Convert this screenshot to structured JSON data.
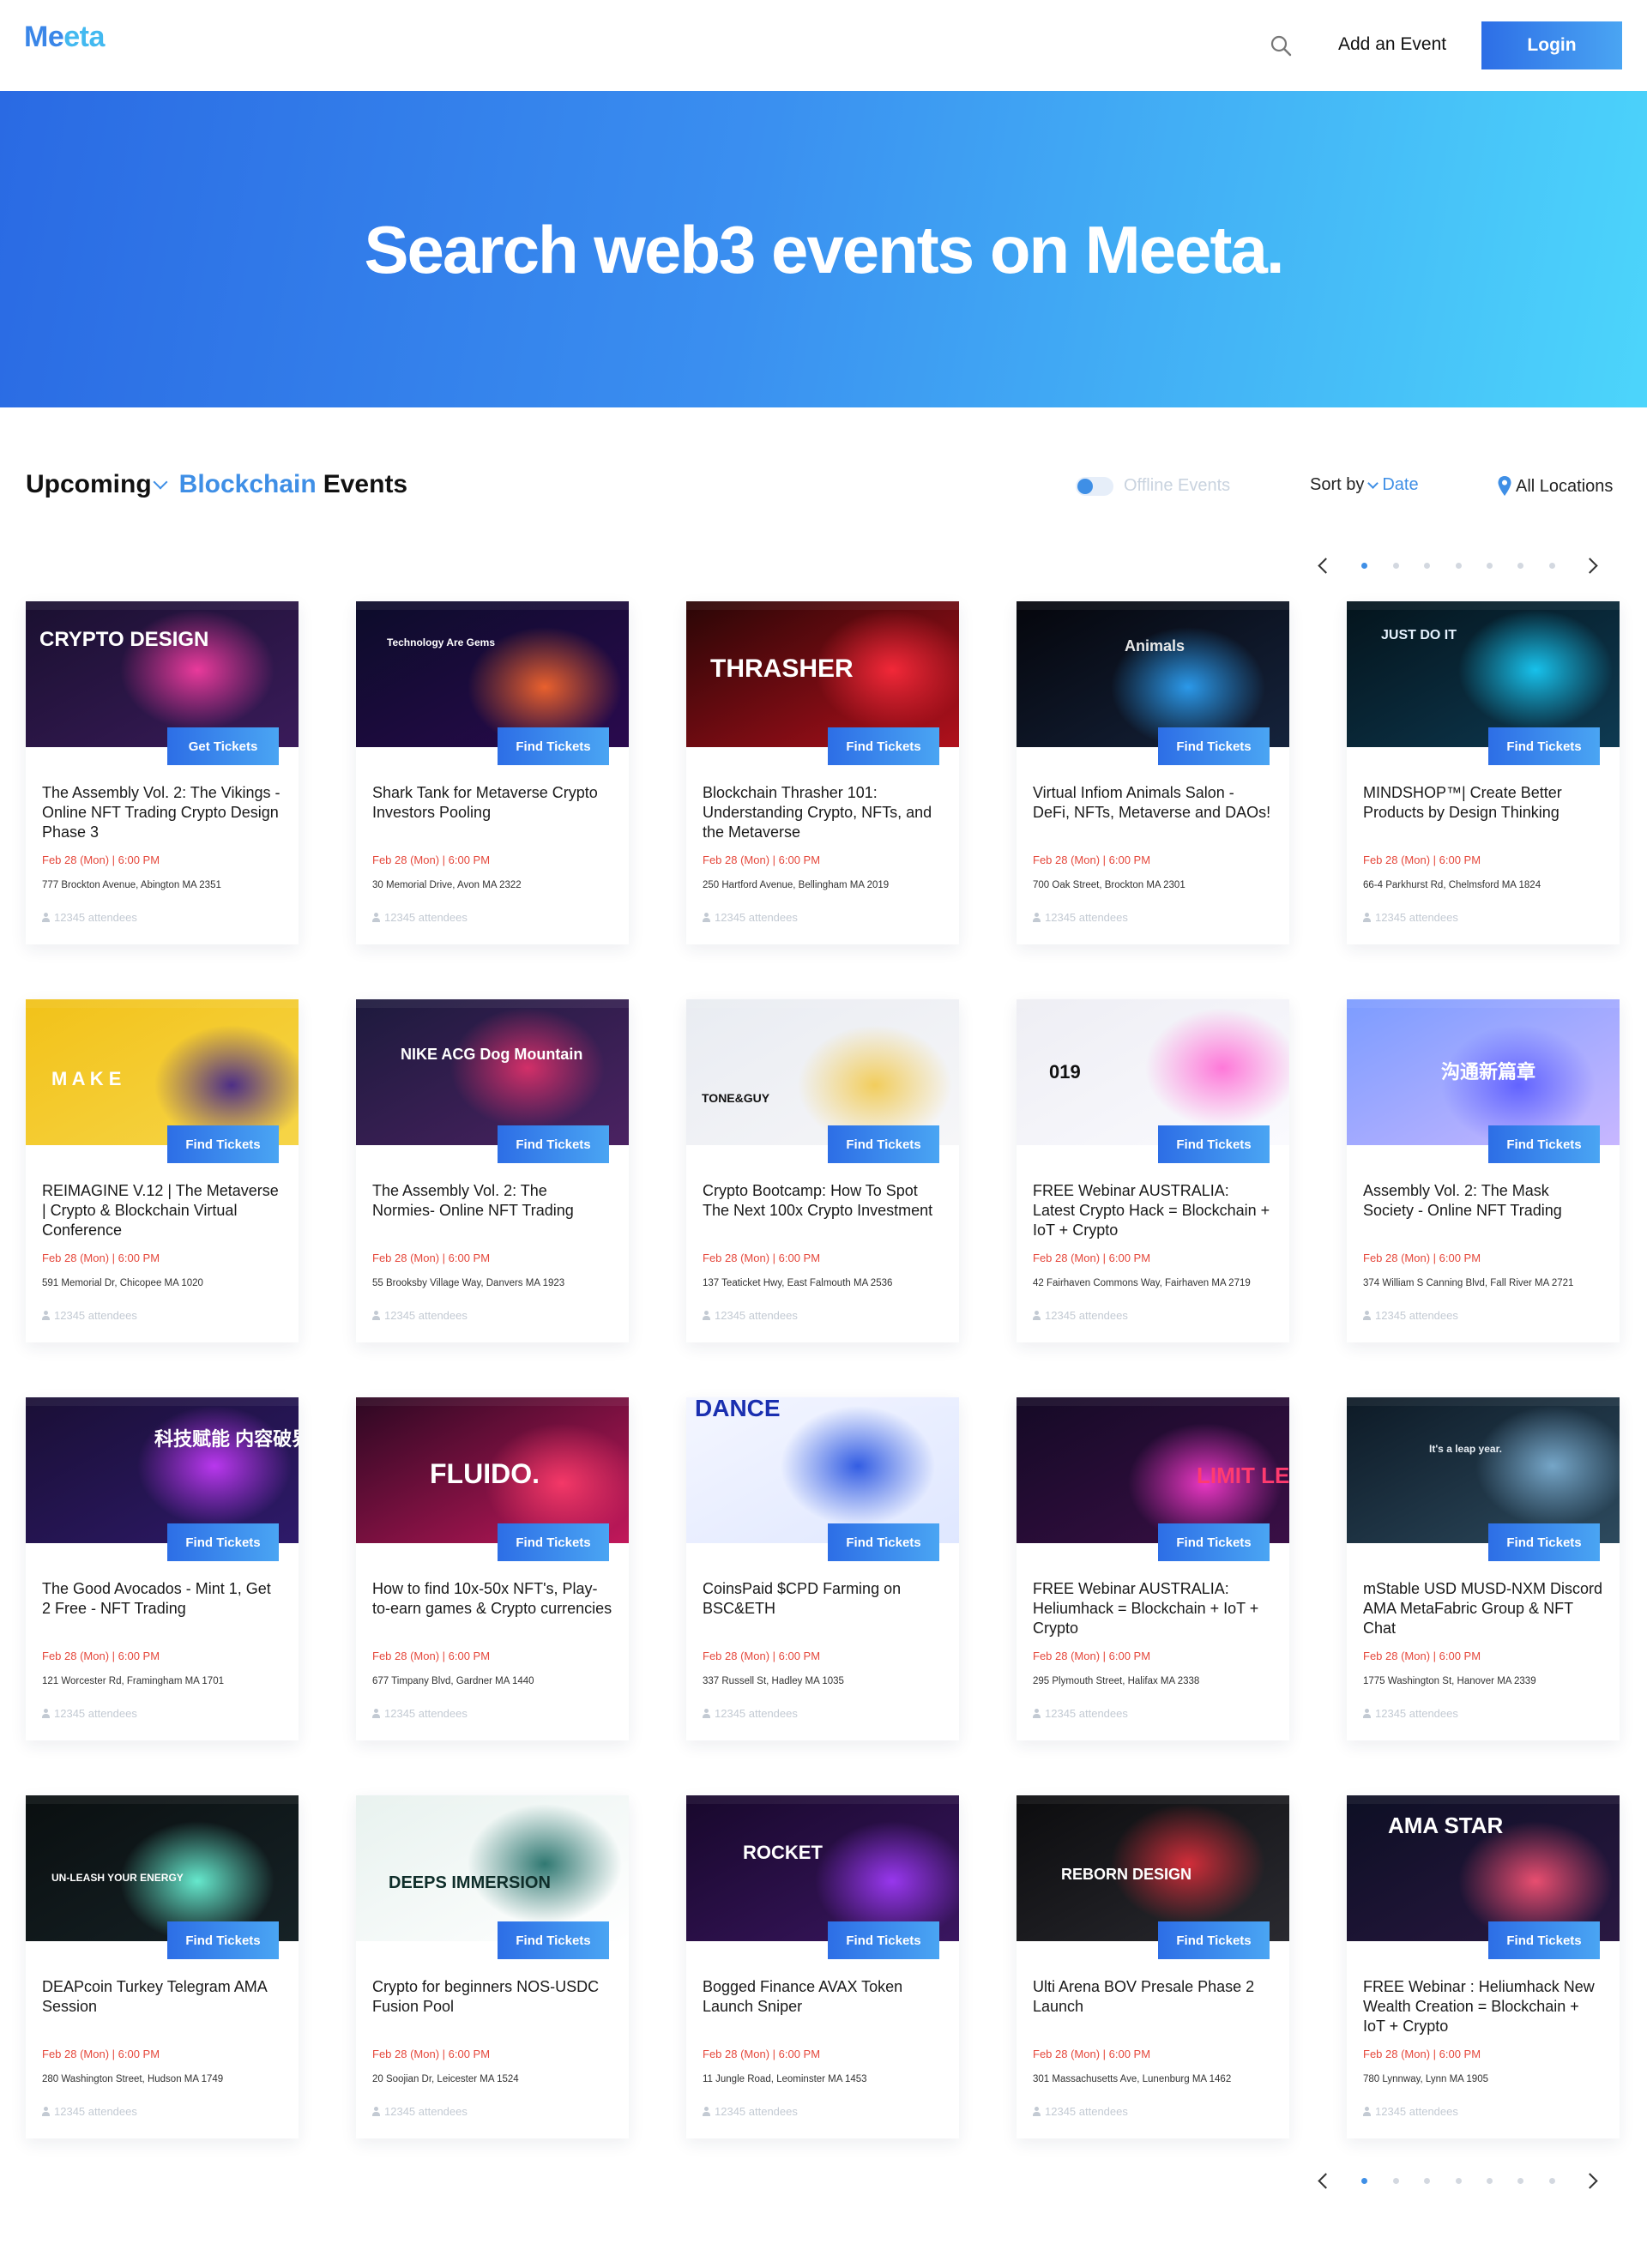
{
  "header": {
    "logo": "Meeta",
    "add_event_label": "Add an Event",
    "login_label": "Login"
  },
  "hero": {
    "title": "Search web3 events on Meeta."
  },
  "toolbar": {
    "time_filter": "Upcoming",
    "category_filter": "Blockchain",
    "events_word": "Events",
    "offline_label": "Offline Events",
    "sort_label": "Sort by",
    "sort_value": "Date",
    "location_label": "All Locations"
  },
  "pager": {
    "pages": 7,
    "active": 1
  },
  "colors": {
    "accent": "#3f8fe6",
    "date_red": "#e5483c",
    "brand_gradient_start": "#2a6ae3",
    "brand_gradient_end": "#4cd5fb"
  },
  "events": [
    {
      "title": "The Assembly Vol. 2: The Vikings - Online NFT Trading Crypto Design Phase 3",
      "date": "Feb 28 (Mon) | 6:00 PM",
      "address": "777 Brockton Avenue, Abington MA 2351",
      "attendees": "12345 attendees",
      "button": "Get Tickets",
      "thumb_text": "CRYPTO DESIGN"
    },
    {
      "title": "Shark Tank for Metaverse Crypto Investors Pooling",
      "date": "Feb 28 (Mon) | 6:00 PM",
      "address": "30 Memorial Drive, Avon MA 2322",
      "attendees": "12345 attendees",
      "button": "Find Tickets",
      "thumb_text": "Technology Are Gems"
    },
    {
      "title": "Blockchain Thrasher 101: Understanding Crypto, NFTs, and the Metaverse",
      "date": "Feb 28 (Mon) | 6:00 PM",
      "address": "250 Hartford Avenue, Bellingham MA 2019",
      "attendees": "12345 attendees",
      "button": "Find Tickets",
      "thumb_text": "THRASHER"
    },
    {
      "title": "Virtual Infiom Animals Salon - DeFi, NFTs, Metaverse and DAOs!",
      "date": "Feb 28 (Mon) | 6:00 PM",
      "address": "700 Oak Street, Brockton MA 2301",
      "attendees": "12345 attendees",
      "button": "Find Tickets",
      "thumb_text": "Animals"
    },
    {
      "title": "MINDSHOP™| Create Better Products by Design Thinking",
      "date": "Feb 28 (Mon) | 6:00 PM",
      "address": "66-4 Parkhurst Rd, Chelmsford MA 1824",
      "attendees": "12345 attendees",
      "button": "Find Tickets",
      "thumb_text": "JUST DO IT"
    },
    {
      "title": "REIMAGINE V.12 | The Metaverse | Crypto & Blockchain Virtual Conference",
      "date": "Feb 28 (Mon) | 6:00 PM",
      "address": "591 Memorial Dr, Chicopee MA 1020",
      "attendees": "12345 attendees",
      "button": "Find Tickets",
      "thumb_text": "M A K E"
    },
    {
      "title": "The Assembly Vol. 2: The Normies- Online NFT Trading",
      "date": "Feb 28 (Mon) | 6:00 PM",
      "address": "55 Brooksby Village Way, Danvers MA 1923",
      "attendees": "12345 attendees",
      "button": "Find Tickets",
      "thumb_text": "NIKE ACG Dog Mountain"
    },
    {
      "title": "Crypto Bootcamp: How To Spot The Next 100x Crypto Investment",
      "date": "Feb 28 (Mon) | 6:00 PM",
      "address": "137 Teaticket Hwy, East Falmouth MA 2536",
      "attendees": "12345 attendees",
      "button": "Find Tickets",
      "thumb_text": "TONE&GUY"
    },
    {
      "title": "FREE Webinar AUSTRALIA: Latest Crypto Hack = Blockchain + IoT + Crypto",
      "date": "Feb 28 (Mon) | 6:00 PM",
      "address": "42 Fairhaven Commons Way, Fairhaven MA 2719",
      "attendees": "12345 attendees",
      "button": "Find Tickets",
      "thumb_text": "019"
    },
    {
      "title": "Assembly Vol. 2: The Mask Society - Online NFT Trading",
      "date": "Feb 28 (Mon) | 6:00 PM",
      "address": "374 William S Canning Blvd, Fall River MA 2721",
      "attendees": "12345 attendees",
      "button": "Find Tickets",
      "thumb_text": "沟通新篇章"
    },
    {
      "title": "The Good Avocados - Mint 1, Get 2 Free - NFT Trading",
      "date": "Feb 28 (Mon) | 6:00 PM",
      "address": "121 Worcester Rd, Framingham MA 1701",
      "attendees": "12345 attendees",
      "button": "Find Tickets",
      "thumb_text": "科技赋能 内容破界"
    },
    {
      "title": "How to find 10x-50x NFT's, Play-to-earn games & Crypto currencies",
      "date": "Feb 28 (Mon) | 6:00 PM",
      "address": "677 Timpany Blvd, Gardner MA 1440",
      "attendees": "12345 attendees",
      "button": "Find Tickets",
      "thumb_text": "FLUIDO."
    },
    {
      "title": "CoinsPaid $CPD Farming on BSC&ETH",
      "date": "Feb 28 (Mon) | 6:00 PM",
      "address": "337 Russell St, Hadley MA 1035",
      "attendees": "12345 attendees",
      "button": "Find Tickets",
      "thumb_text": "DANCE"
    },
    {
      "title": "FREE Webinar AUSTRALIA: Heliumhack = Blockchain + IoT + Crypto",
      "date": "Feb 28 (Mon) | 6:00 PM",
      "address": "295 Plymouth Street, Halifax MA 2338",
      "attendees": "12345 attendees",
      "button": "Find Tickets",
      "thumb_text": "LIMIT LESS"
    },
    {
      "title": "mStable USD MUSD-NXM Discord AMA MetaFabric Group & NFT Chat",
      "date": "Feb 28 (Mon) | 6:00 PM",
      "address": "1775 Washington St, Hanover MA 2339",
      "attendees": "12345 attendees",
      "button": "Find Tickets",
      "thumb_text": "It's a leap year."
    },
    {
      "title": "DEAPcoin Turkey Telegram AMA Session",
      "date": "Feb 28 (Mon) | 6:00 PM",
      "address": "280 Washington Street, Hudson MA 1749",
      "attendees": "12345 attendees",
      "button": "Find Tickets",
      "thumb_text": "UN-LEASH YOUR ENERGY"
    },
    {
      "title": "Crypto for beginners NOS-USDC Fusion Pool",
      "date": "Feb 28 (Mon) | 6:00 PM",
      "address": "20 Soojian Dr, Leicester MA 1524",
      "attendees": "12345 attendees",
      "button": "Find Tickets",
      "thumb_text": "DEEPS IMMERSION"
    },
    {
      "title": "Bogged Finance AVAX Token Launch Sniper",
      "date": "Feb 28 (Mon) | 6:00 PM",
      "address": "11 Jungle Road, Leominster MA 1453",
      "attendees": "12345 attendees",
      "button": "Find Tickets",
      "thumb_text": "ROCKET"
    },
    {
      "title": "Ulti Arena BOV Presale Phase 2 Launch",
      "date": "Feb 28 (Mon) | 6:00 PM",
      "address": "301 Massachusetts Ave, Lunenburg MA 1462",
      "attendees": "12345 attendees",
      "button": "Find Tickets",
      "thumb_text": "REBORN DESIGN"
    },
    {
      "title": "FREE Webinar : Heliumhack New Wealth Creation = Blockchain + IoT + Crypto",
      "date": "Feb 28 (Mon) | 6:00 PM",
      "address": "780 Lynnway, Lynn MA 1905",
      "attendees": "12345 attendees",
      "button": "Find Tickets",
      "thumb_text": "AMA STAR"
    }
  ]
}
